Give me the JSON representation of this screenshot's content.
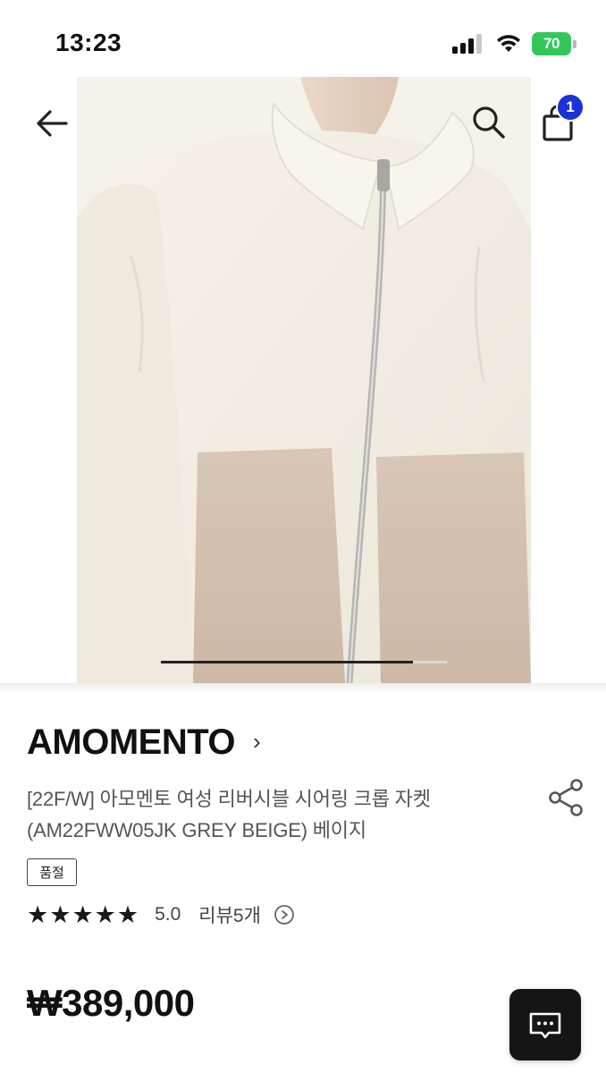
{
  "status_bar": {
    "time": "13:23",
    "battery": "70",
    "battery_color": "#33c759"
  },
  "nav": {
    "back_icon": "arrow-left-icon",
    "search_icon": "search-icon",
    "cart_icon": "shopping-bag-icon",
    "cart_count": "1",
    "badge_color": "#1a33d6"
  },
  "hero": {
    "image_subject": "product photo of cream sherpa fleece zip jacket with beige pockets",
    "carousel_progress": 0.88
  },
  "product": {
    "brand": "AMOMENTO",
    "brand_chevron": "›",
    "title_line1": "[22F/W] 아모멘토 여성 리버시블 시어링 크롭 자켓",
    "title_line2": "(AM22FWW05JK GREY BEIGE) 베이지",
    "share_icon": "share-icon",
    "status_badge": "품절",
    "rating_stars": 5,
    "rating_value": "5.0",
    "review_label": "리뷰5개",
    "price": "₩389,000"
  },
  "chat": {
    "icon": "chat-bubble-icon"
  }
}
